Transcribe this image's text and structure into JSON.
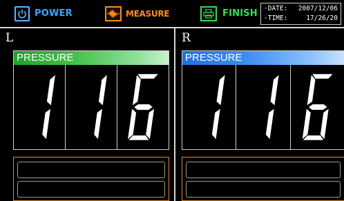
{
  "topbar": {
    "power_label": "POWER",
    "measure_label": "MEASURE",
    "finish_label": "FINISH",
    "date_label": "·DATE:",
    "date_value": "2007/12/06",
    "time_label": "·TIME:",
    "time_value": "17/26/20"
  },
  "left_panel": {
    "side_label": "L",
    "pressure_label": "PRESSURE",
    "digits": [
      "1",
      "1",
      "6"
    ],
    "header_color": "#44c24a"
  },
  "right_panel": {
    "side_label": "R",
    "pressure_label": "PRESSURE",
    "digits": [
      "1",
      "1",
      "6"
    ],
    "header_color": "#3d8ef2"
  },
  "icons": {
    "power": "power-icon",
    "measure": "waveform-icon",
    "finish": "printer-icon"
  },
  "colors": {
    "power": "#3da5ff",
    "measure": "#ff8a1c",
    "finish": "#33e04f",
    "message_border": "#e08a1c"
  }
}
